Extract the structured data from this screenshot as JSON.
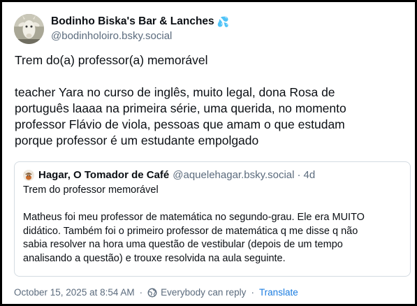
{
  "author": {
    "display_name": "Bodinho Biska's Bar & Lanches",
    "emoji": "💦",
    "handle": "@bodinholoiro.bsky.social",
    "avatar_icon": "goat-avatar"
  },
  "post": {
    "line1": "Trem do(a) professor(a) memorável",
    "paragraph": [
      "teacher Yara no curso de inglês, muito legal, dona Rosa de",
      "português laaaa na primeira série, uma querida, no momento",
      "professor Flávio de viola, pessoas que amam o que estudam",
      "porque professor é um estudante empolgado"
    ]
  },
  "quote": {
    "display_name": "Hagar, O Tomador de Café",
    "handle": "@aquelehagar.bsky.social",
    "separator": "·",
    "time": "4d",
    "avatar_icon": "viking-avatar",
    "title": "Trem do professor memorável",
    "body_lines": [
      "Matheus foi meu professor de matemática no segundo-grau. Ele era MUITO",
      "didático. Também foi o primeiro professor de matemática q me disse q não",
      "sabia resolver na hora uma questão de vestibular (depois de um tempo",
      "analisando a questão) e trouxe resolvida na aula seguinte."
    ]
  },
  "meta": {
    "timestamp": "October 15, 2025 at 8:54 AM",
    "sep1": "·",
    "reply_setting": "Everybody can reply",
    "sep2": "·",
    "translate": "Translate"
  },
  "colors": {
    "text": "#0b0f14",
    "secondary": "#5b6b7d",
    "link": "#1a7ce0",
    "border": "#d4dbe2"
  }
}
